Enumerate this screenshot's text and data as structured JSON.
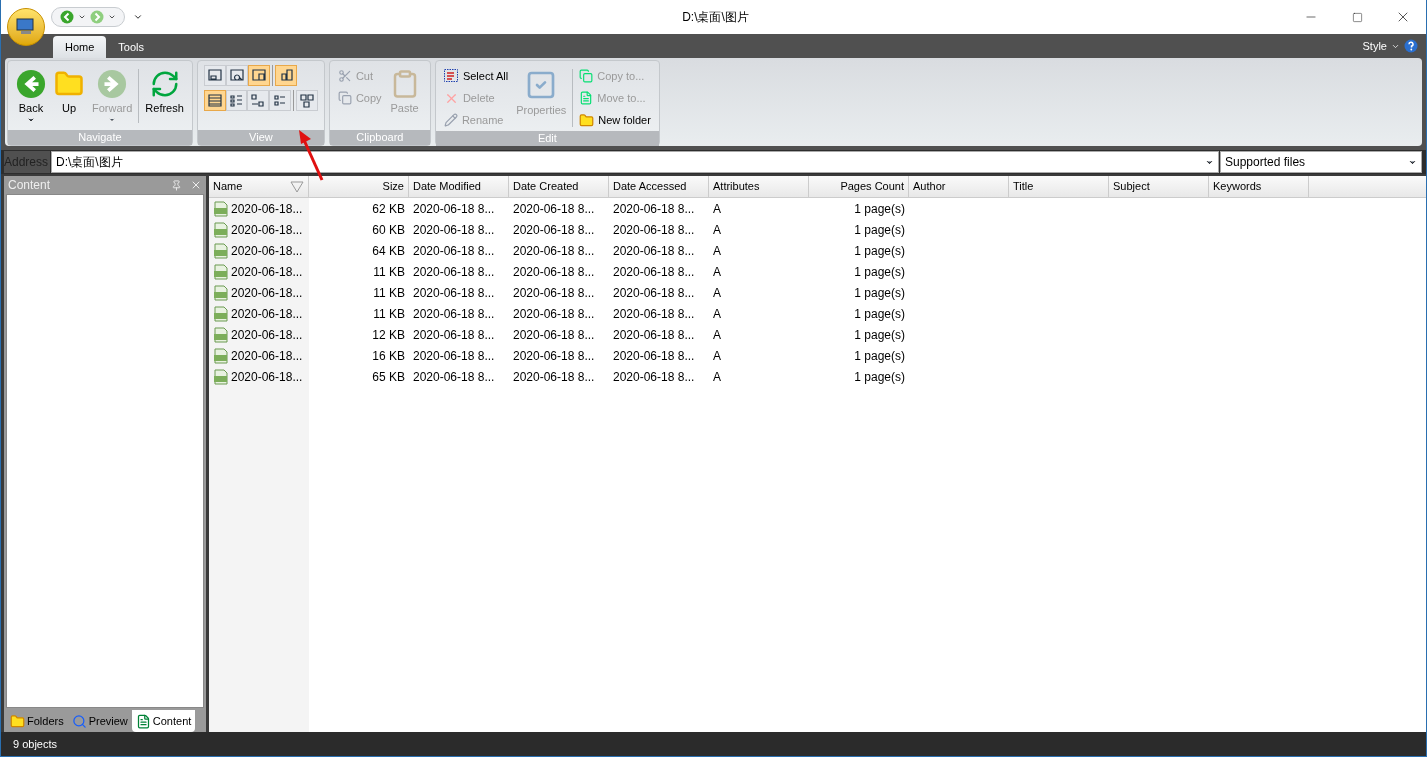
{
  "window": {
    "title": "D:\\桌面\\图片"
  },
  "tabs": [
    {
      "label": "Home",
      "selected": true
    },
    {
      "label": "Tools",
      "selected": false
    }
  ],
  "style_menu": {
    "label": "Style"
  },
  "ribbon": [
    {
      "kind": "big",
      "title": "Navigate",
      "buttons": [
        {
          "label": "Back",
          "disabled": false,
          "dropdown": true
        },
        {
          "label": "Up",
          "disabled": false,
          "dropdown": false
        },
        {
          "label": "Forward",
          "disabled": true,
          "dropdown": true
        },
        {
          "label": "Refresh",
          "disabled": false,
          "dropdown": false
        }
      ]
    },
    {
      "kind": "view",
      "title": "View",
      "top": [
        {
          "selected": false
        },
        {
          "selected": false
        },
        {
          "selected": true
        },
        {
          "selected": true
        }
      ],
      "bottom": [
        {
          "selected": true
        },
        {
          "selected": false
        },
        {
          "selected": false
        },
        {
          "selected": false
        },
        {
          "selected": false
        }
      ]
    },
    {
      "kind": "clip",
      "title": "Clipboard",
      "small": [
        {
          "label": "Cut",
          "disabled": true
        },
        {
          "label": "Copy",
          "disabled": true
        }
      ],
      "big": {
        "label": "Paste",
        "disabled": true
      }
    },
    {
      "kind": "edit",
      "title": "Edit",
      "small": [
        {
          "label": "Select All",
          "disabled": false
        },
        {
          "label": "Delete",
          "disabled": true
        },
        {
          "label": "Rename",
          "disabled": true
        }
      ],
      "big": {
        "label": "Properties",
        "disabled": true
      },
      "small2": [
        {
          "label": "Copy to...",
          "disabled": true
        },
        {
          "label": "Move to...",
          "disabled": true
        },
        {
          "label": "New folder",
          "disabled": false
        }
      ]
    }
  ],
  "address": {
    "label": "Address",
    "value": "D:\\桌面\\图片",
    "filter": "Supported files"
  },
  "side_panel": {
    "title": "Content",
    "tabs": [
      {
        "label": "Folders",
        "selected": false
      },
      {
        "label": "Preview",
        "selected": false
      },
      {
        "label": "Content",
        "selected": true
      }
    ]
  },
  "table": {
    "columns": [
      "Name",
      "Size",
      "Date Modified",
      "Date Created",
      "Date Accessed",
      "Attributes",
      "Pages Count",
      "Author",
      "Title",
      "Subject",
      "Keywords"
    ],
    "rows": [
      [
        "2020-06-18...",
        "62 KB",
        "2020-06-18 8...",
        "2020-06-18 8...",
        "2020-06-18 8...",
        "A",
        "1 page(s)"
      ],
      [
        "2020-06-18...",
        "60 KB",
        "2020-06-18 8...",
        "2020-06-18 8...",
        "2020-06-18 8...",
        "A",
        "1 page(s)"
      ],
      [
        "2020-06-18...",
        "64 KB",
        "2020-06-18 8...",
        "2020-06-18 8...",
        "2020-06-18 8...",
        "A",
        "1 page(s)"
      ],
      [
        "2020-06-18...",
        "11 KB",
        "2020-06-18 8...",
        "2020-06-18 8...",
        "2020-06-18 8...",
        "A",
        "1 page(s)"
      ],
      [
        "2020-06-18...",
        "11 KB",
        "2020-06-18 8...",
        "2020-06-18 8...",
        "2020-06-18 8...",
        "A",
        "1 page(s)"
      ],
      [
        "2020-06-18...",
        "11 KB",
        "2020-06-18 8...",
        "2020-06-18 8...",
        "2020-06-18 8...",
        "A",
        "1 page(s)"
      ],
      [
        "2020-06-18...",
        "12 KB",
        "2020-06-18 8...",
        "2020-06-18 8...",
        "2020-06-18 8...",
        "A",
        "1 page(s)"
      ],
      [
        "2020-06-18...",
        "16 KB",
        "2020-06-18 8...",
        "2020-06-18 8...",
        "2020-06-18 8...",
        "A",
        "1 page(s)"
      ],
      [
        "2020-06-18...",
        "65 KB",
        "2020-06-18 8...",
        "2020-06-18 8...",
        "2020-06-18 8...",
        "A",
        "1 page(s)"
      ]
    ]
  },
  "status_bar": {
    "text": "9 objects"
  }
}
